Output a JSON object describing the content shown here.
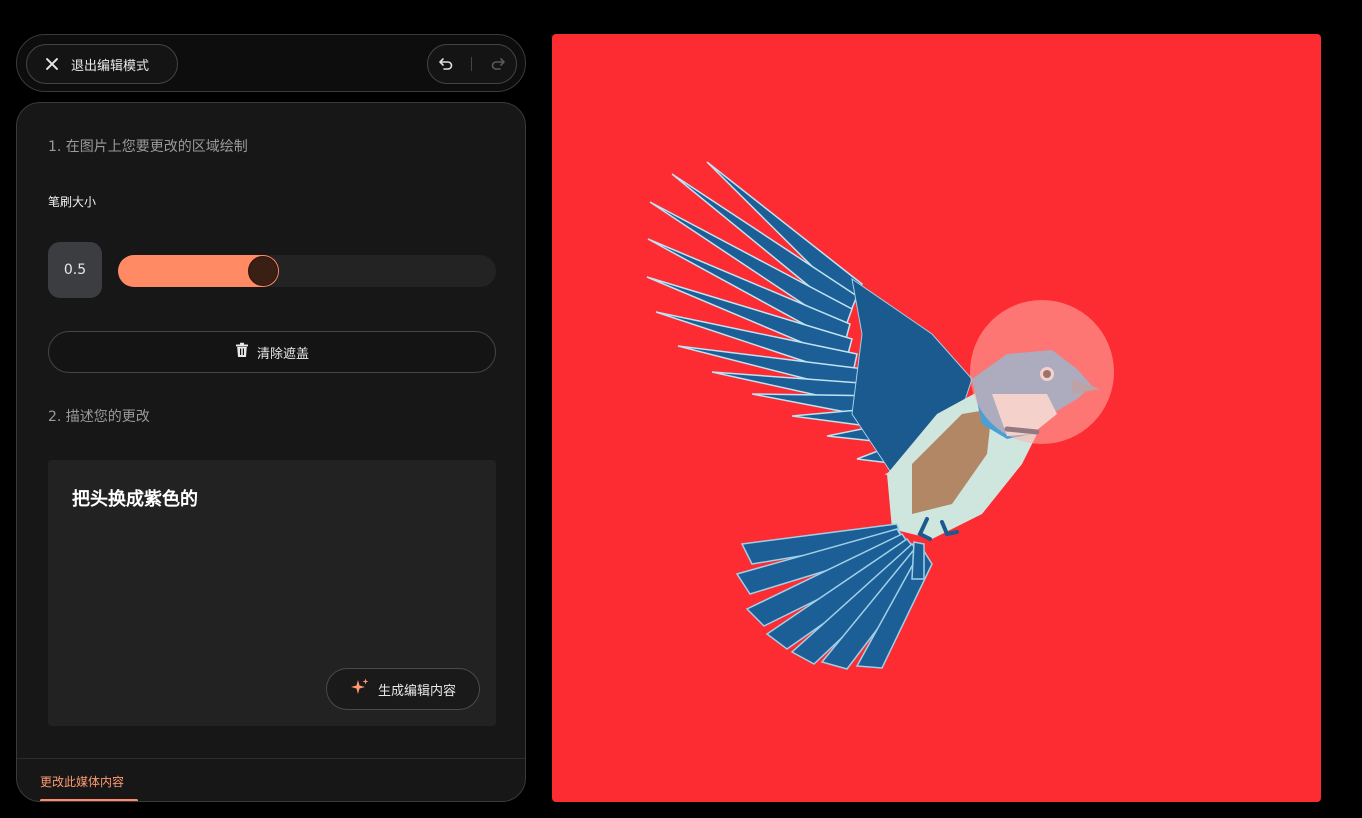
{
  "topbar": {
    "exit_label": "退出编辑模式"
  },
  "panel": {
    "step1": "1. 在图片上您要更改的区域绘制",
    "brush_label": "笔刷大小",
    "brush_value": "0.5",
    "brush_level_fraction": 0.39,
    "clear_label": "清除遮盖",
    "step2": "2. 描述您的更改",
    "prompt": "把头换成紫色的",
    "generate_label": "生成编辑内容",
    "footer_tab": "更改此媒体内容"
  },
  "colors": {
    "accent": "#ff8a64",
    "image_background": "#fd2b32",
    "bird_blue": "#1c5f96",
    "mask_overlay": "#ffb4ac"
  }
}
